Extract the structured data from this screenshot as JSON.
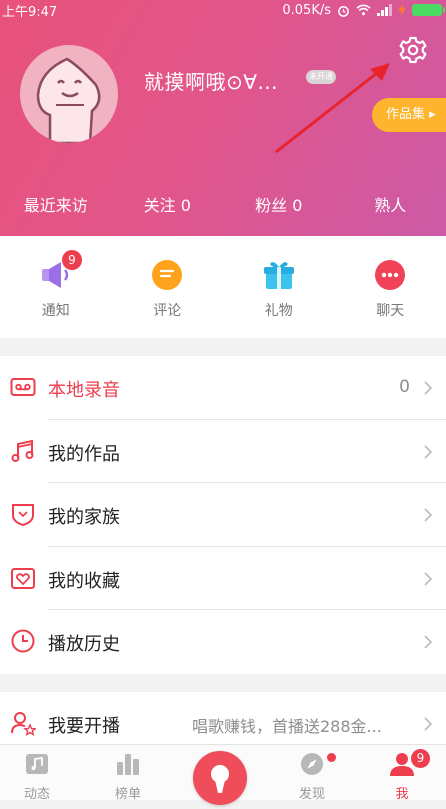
{
  "status_bar": {
    "time": "上午9:47",
    "network_speed": "0.05K/s"
  },
  "profile": {
    "nickname": "就摸啊哦⊙∀...",
    "vip_badge": "未开通",
    "works_button": "作品集"
  },
  "stats": [
    {
      "label": "最近来访"
    },
    {
      "label": "关注 0"
    },
    {
      "label": "粉丝 0"
    },
    {
      "label": "熟人"
    }
  ],
  "shortcuts": [
    {
      "label": "通知",
      "badge": "9",
      "icon": "speaker-icon"
    },
    {
      "label": "评论",
      "icon": "comment-icon"
    },
    {
      "label": "礼物",
      "icon": "gift-icon"
    },
    {
      "label": "聊天",
      "icon": "chat-icon"
    }
  ],
  "menu": [
    {
      "label": "本地录音",
      "value": "0",
      "icon": "cassette-icon"
    },
    {
      "label": "我的作品",
      "icon": "music-note-icon"
    },
    {
      "label": "我的家族",
      "icon": "shield-icon"
    },
    {
      "label": "我的收藏",
      "icon": "heart-icon"
    },
    {
      "label": "播放历史",
      "icon": "clock-icon"
    }
  ],
  "broadcast": {
    "label": "我要开播",
    "hint": "唱歌赚钱，首播送288金...",
    "icon": "user-star-icon"
  },
  "tabbar": {
    "items": [
      {
        "label": "动态"
      },
      {
        "label": "榜单"
      },
      {
        "label": "发现"
      },
      {
        "label": "我",
        "badge": "9"
      }
    ]
  },
  "colors": {
    "accent": "#ee3d4d",
    "header_start": "#e8517a",
    "header_end": "#cc5aa6",
    "works": "#ffb42e"
  }
}
